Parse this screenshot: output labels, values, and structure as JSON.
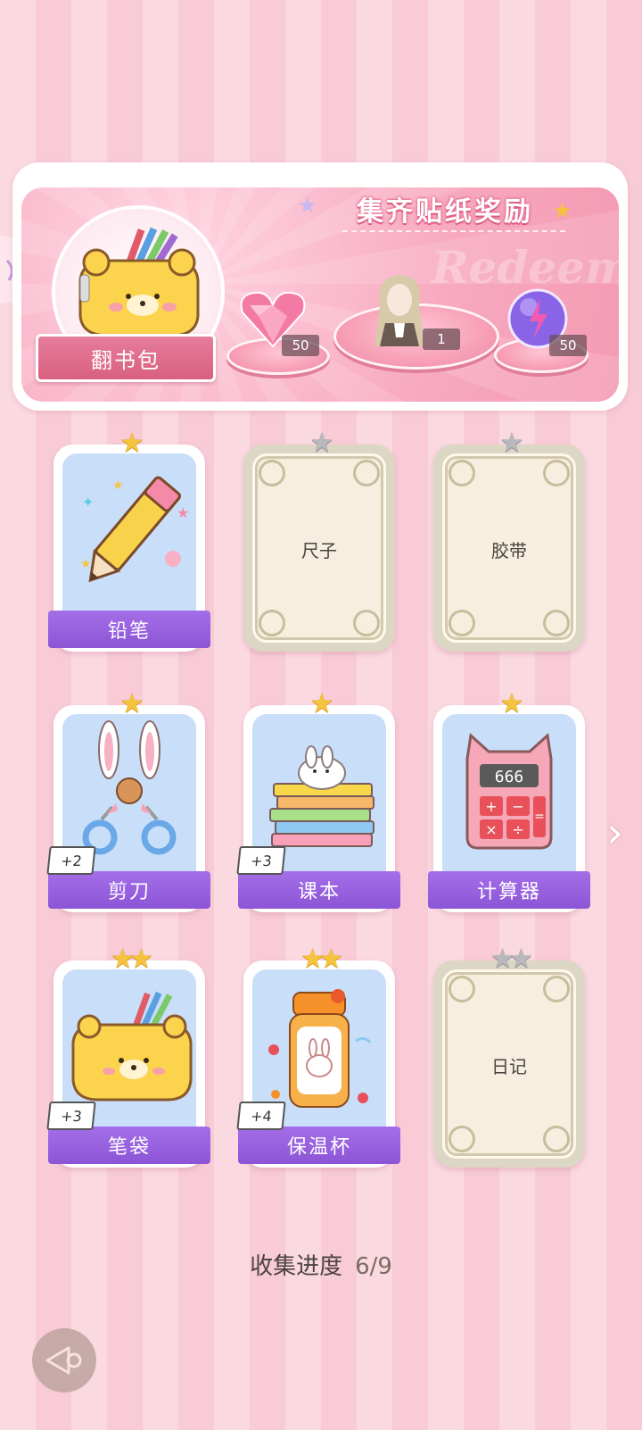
{
  "reward_banner": {
    "title": "集齐贴纸奖励",
    "watermark": "Redeem",
    "bag_label": "翻书包",
    "rewards": [
      {
        "icon": "pink-diamond-heart-icon",
        "count": "50"
      },
      {
        "icon": "character-outfit-icon",
        "count": "1"
      },
      {
        "icon": "purple-energy-orb-icon",
        "count": "50"
      }
    ]
  },
  "stickers": [
    {
      "name": "铅笔",
      "collected": true,
      "stars": 1,
      "bonus": ""
    },
    {
      "name": "尺子",
      "collected": false,
      "stars": 1,
      "bonus": ""
    },
    {
      "name": "胶带",
      "collected": false,
      "stars": 1,
      "bonus": ""
    },
    {
      "name": "剪刀",
      "collected": true,
      "stars": 1,
      "bonus": "+2"
    },
    {
      "name": "课本",
      "collected": true,
      "stars": 1,
      "bonus": "+3"
    },
    {
      "name": "计算器",
      "collected": true,
      "stars": 1,
      "bonus": "",
      "screen_text": "666"
    },
    {
      "name": "笔袋",
      "collected": true,
      "stars": 2,
      "bonus": "+3"
    },
    {
      "name": "保温杯",
      "collected": true,
      "stars": 2,
      "bonus": "+4"
    },
    {
      "name": "日记",
      "collected": false,
      "stars": 2,
      "bonus": ""
    }
  ],
  "progress": {
    "label": "收集进度",
    "value": "6/9"
  },
  "colors": {
    "ribbon": "#9a62e0",
    "accent_pink": "#f49ab3",
    "star_gold": "#f6c33d"
  }
}
